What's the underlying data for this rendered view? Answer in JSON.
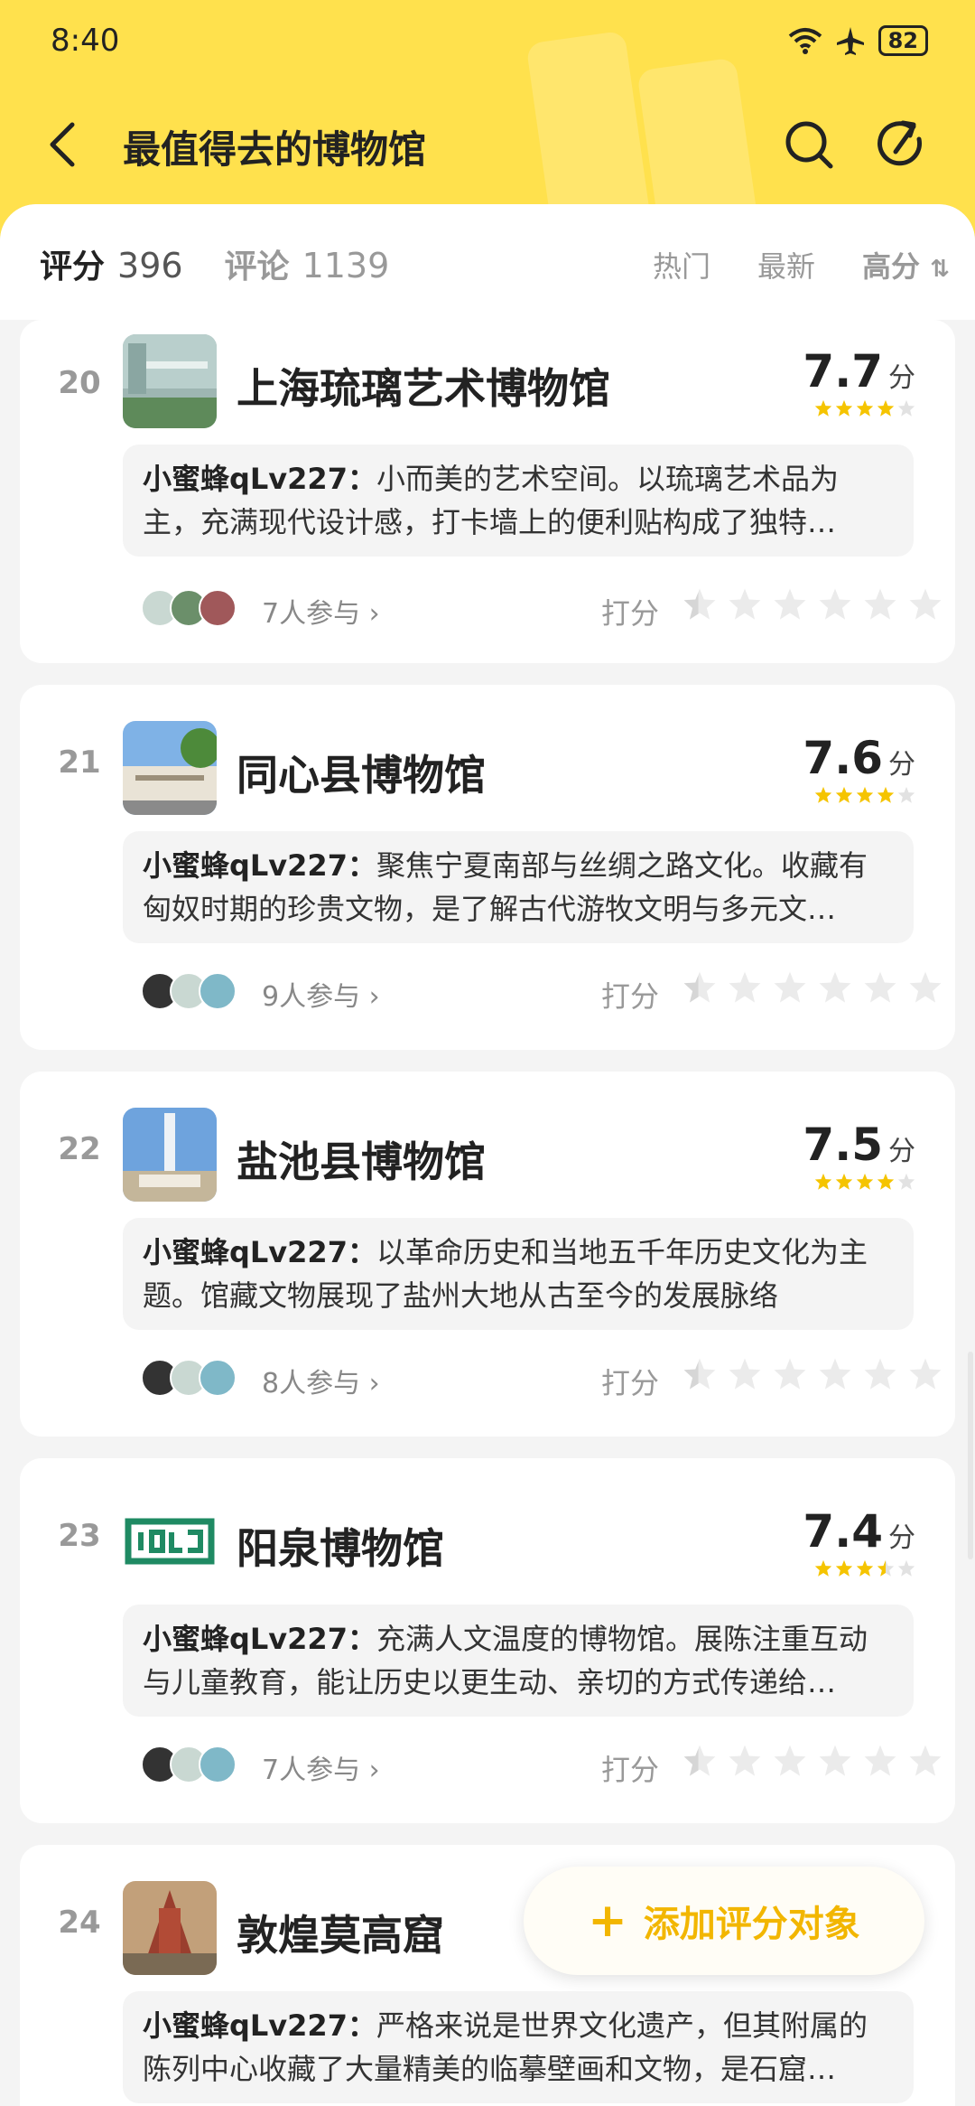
{
  "status": {
    "time": "8:40",
    "battery": "82"
  },
  "header": {
    "title": "最值得去的博物馆"
  },
  "tabs": {
    "score_label": "评分",
    "score_count": "396",
    "comment_label": "评论",
    "comment_count": "1139",
    "sort": [
      "热门",
      "最新",
      "高分"
    ]
  },
  "items": [
    {
      "rank": "20",
      "name": "上海琉璃艺术博物馆",
      "score": "7.7",
      "unit": "分",
      "stars": 4,
      "author": "小蜜蜂qLv227：",
      "review": "小而美的艺术空间。以琉璃艺术品为主，充满现代设计感，打卡墙上的便利贴构成了独特…",
      "participants": "7人参与",
      "rate": "打分"
    },
    {
      "rank": "21",
      "name": "同心县博物馆",
      "score": "7.6",
      "unit": "分",
      "stars": 4,
      "author": "小蜜蜂qLv227：",
      "review": "聚焦宁夏南部与丝绸之路文化。收藏有匈奴时期的珍贵文物，是了解古代游牧文明与多元文…",
      "participants": "9人参与",
      "rate": "打分"
    },
    {
      "rank": "22",
      "name": "盐池县博物馆",
      "score": "7.5",
      "unit": "分",
      "stars": 4,
      "author": "小蜜蜂qLv227：",
      "review": "以革命历史和当地五千年历史文化为主题。馆藏文物展现了盐州大地从古至今的发展脉络",
      "participants": "8人参与",
      "rate": "打分"
    },
    {
      "rank": "23",
      "name": "阳泉博物馆",
      "score": "7.4",
      "unit": "分",
      "stars": 3.5,
      "author": "小蜜蜂qLv227：",
      "review": "充满人文温度的博物馆。展陈注重互动与儿童教育，能让历史以更生动、亲切的方式传递给…",
      "participants": "7人参与",
      "rate": "打分"
    },
    {
      "rank": "24",
      "name": "敦煌莫高窟",
      "score": "",
      "unit": "",
      "stars": 0,
      "author": "小蜜蜂qLv227：",
      "review": "严格来说是世界文化遗产，但其附属的陈列中心收藏了大量精美的临摹壁画和文物，是石窟…",
      "participants": "",
      "rate": ""
    }
  ],
  "fab": {
    "label": "添加评分对象"
  }
}
